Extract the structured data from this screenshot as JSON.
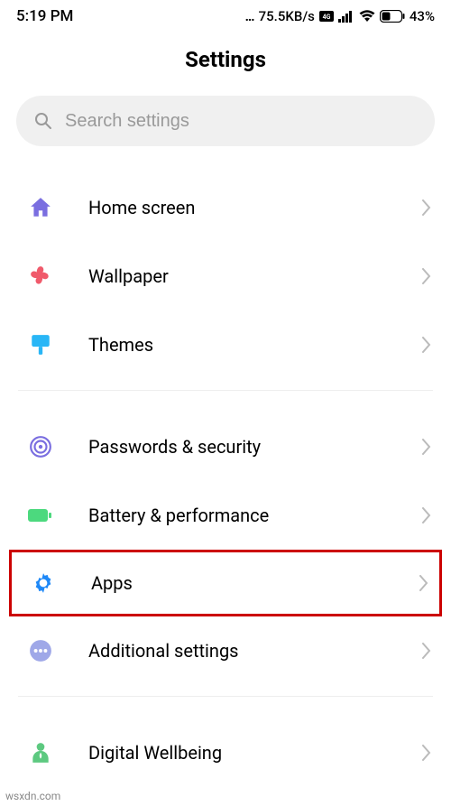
{
  "status": {
    "time": "5:19 PM",
    "network_speed": "75.5KB/s",
    "battery": "43%"
  },
  "page_title": "Settings",
  "search": {
    "placeholder": "Search settings"
  },
  "items": [
    {
      "label": "Home screen",
      "icon": "home",
      "color": "#7a6ee0"
    },
    {
      "label": "Wallpaper",
      "icon": "flower",
      "color": "#f05a6b"
    },
    {
      "label": "Themes",
      "icon": "brush",
      "color": "#29b6f6"
    },
    {
      "label": "Passwords & security",
      "icon": "fingerprint",
      "color": "#7a6ee0"
    },
    {
      "label": "Battery & performance",
      "icon": "battery",
      "color": "#4cd97e"
    },
    {
      "label": "Apps",
      "icon": "gear",
      "color": "#1e88f7",
      "highlighted": true
    },
    {
      "label": "Additional settings",
      "icon": "dots",
      "color": "#9fa8e8"
    },
    {
      "label": "Digital Wellbeing",
      "icon": "wellbeing",
      "color": "#5dc980"
    }
  ],
  "watermark": "wsxdn.com"
}
